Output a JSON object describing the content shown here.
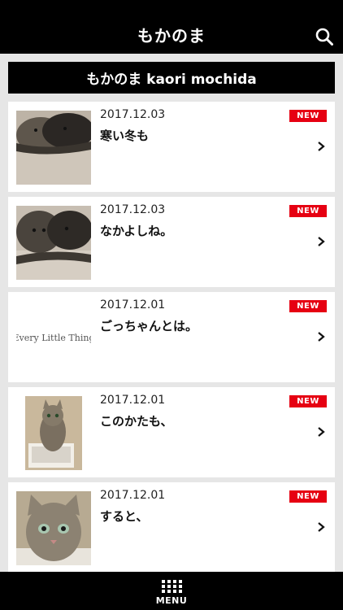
{
  "header": {
    "title": "もかのま",
    "search_icon": "search-icon"
  },
  "banner": {
    "label": "もかのま kaori mochida"
  },
  "posts": [
    {
      "date": "2017.12.03",
      "title": "寒い冬も",
      "badge": "NEW",
      "thumb": "cats-sleeping-photo"
    },
    {
      "date": "2017.12.03",
      "title": "なかよしね。",
      "badge": "NEW",
      "thumb": "cats-together-photo"
    },
    {
      "date": "2017.12.01",
      "title": "ごっちゃんとは。",
      "badge": "NEW",
      "thumb_text": "Every Little Thing"
    },
    {
      "date": "2017.12.01",
      "title": "このかたも、",
      "badge": "NEW",
      "thumb": "cat-in-box-photo"
    },
    {
      "date": "2017.12.01",
      "title": "すると、",
      "badge": "NEW",
      "thumb": "cat-closeup-photo"
    }
  ],
  "footer": {
    "menu_label": "MENU",
    "menu_icon": "grid-menu-icon"
  },
  "colors": {
    "bar": "#000000",
    "badge": "#e60012",
    "background": "#e6e6e6"
  }
}
